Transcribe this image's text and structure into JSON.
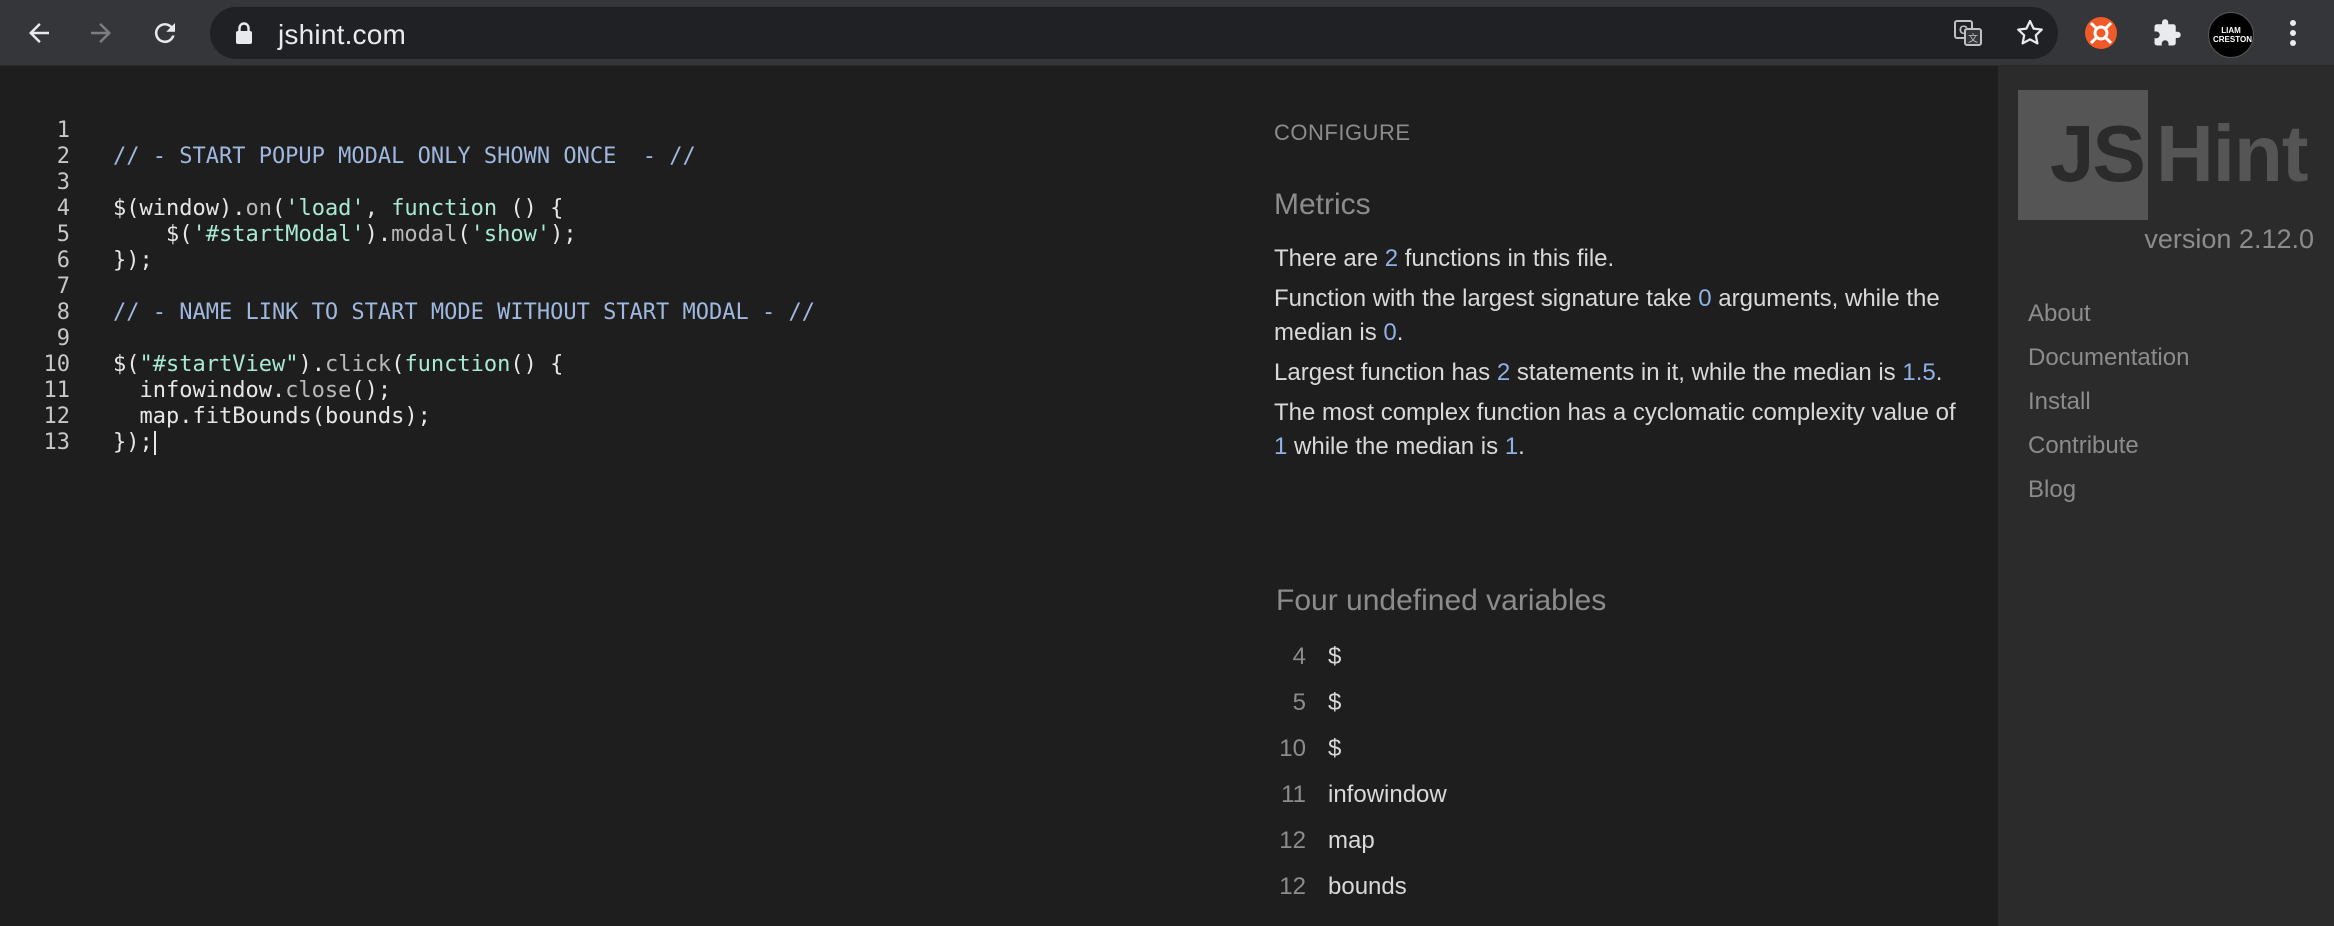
{
  "browser": {
    "url": "jshint.com",
    "profile_initials": "LIAM CRESTON"
  },
  "editor": {
    "lines": [
      {
        "n": "1",
        "tokens": []
      },
      {
        "n": "2",
        "tokens": [
          {
            "t": "// - START POPUP MODAL ONLY SHOWN ONCE  - //",
            "c": "com"
          }
        ]
      },
      {
        "n": "3",
        "tokens": []
      },
      {
        "n": "4",
        "tokens": [
          {
            "t": "$(window).",
            "c": "def"
          },
          {
            "t": "on",
            "c": "prop"
          },
          {
            "t": "(",
            "c": "def"
          },
          {
            "t": "'load'",
            "c": "str"
          },
          {
            "t": ", ",
            "c": "def"
          },
          {
            "t": "function",
            "c": "kw"
          },
          {
            "t": " () {",
            "c": "def"
          }
        ]
      },
      {
        "n": "5",
        "tokens": [
          {
            "t": "    $(",
            "c": "def"
          },
          {
            "t": "'#startModal'",
            "c": "str"
          },
          {
            "t": ").",
            "c": "def"
          },
          {
            "t": "modal",
            "c": "prop"
          },
          {
            "t": "(",
            "c": "def"
          },
          {
            "t": "'show'",
            "c": "str"
          },
          {
            "t": ");",
            "c": "def"
          }
        ]
      },
      {
        "n": "6",
        "tokens": [
          {
            "t": "});",
            "c": "def"
          }
        ]
      },
      {
        "n": "7",
        "tokens": []
      },
      {
        "n": "8",
        "tokens": [
          {
            "t": "// - NAME LINK TO START MODE WITHOUT START MODAL - //",
            "c": "com"
          }
        ]
      },
      {
        "n": "9",
        "tokens": []
      },
      {
        "n": "10",
        "tokens": [
          {
            "t": "$(",
            "c": "def"
          },
          {
            "t": "\"#startView\"",
            "c": "str"
          },
          {
            "t": ").",
            "c": "def"
          },
          {
            "t": "click",
            "c": "prop"
          },
          {
            "t": "(",
            "c": "def"
          },
          {
            "t": "function",
            "c": "kw"
          },
          {
            "t": "() {",
            "c": "def"
          }
        ]
      },
      {
        "n": "11",
        "tokens": [
          {
            "t": "  infowindow.",
            "c": "def"
          },
          {
            "t": "close",
            "c": "prop"
          },
          {
            "t": "();",
            "c": "def"
          }
        ]
      },
      {
        "n": "12",
        "tokens": [
          {
            "t": "  map.",
            "c": "def"
          },
          {
            "t": "fitBounds",
            "c": "def"
          },
          {
            "t": "(bounds);",
            "c": "def"
          }
        ]
      },
      {
        "n": "13",
        "tokens": [
          {
            "t": "});",
            "c": "def"
          }
        ],
        "cursor": true
      }
    ]
  },
  "report": {
    "configure_label": "CONFIGURE",
    "metrics_title": "Metrics",
    "metrics": [
      [
        {
          "t": "There are "
        },
        {
          "t": "2",
          "num": true
        },
        {
          "t": " functions in this file."
        }
      ],
      [
        {
          "t": "Function with the largest signature take "
        },
        {
          "t": "0",
          "num": true
        },
        {
          "t": " arguments, while the median is "
        },
        {
          "t": "0",
          "num": true
        },
        {
          "t": "."
        }
      ],
      [
        {
          "t": "Largest function has "
        },
        {
          "t": "2",
          "num": true
        },
        {
          "t": " statements in it, while the median is "
        },
        {
          "t": "1.5",
          "num": true
        },
        {
          "t": "."
        }
      ],
      [
        {
          "t": "The most complex function has a cyclomatic complexity value of "
        },
        {
          "t": "1",
          "num": true
        },
        {
          "t": " while the median is "
        },
        {
          "t": "1",
          "num": true
        },
        {
          "t": "."
        }
      ]
    ],
    "undefined_title": "Four undefined variables",
    "undefined": [
      {
        "line": "4",
        "name": "$"
      },
      {
        "line": "5",
        "name": "$"
      },
      {
        "line": "10",
        "name": "$"
      },
      {
        "line": "11",
        "name": "infowindow"
      },
      {
        "line": "12",
        "name": "map"
      },
      {
        "line": "12",
        "name": "bounds"
      }
    ]
  },
  "sidebar": {
    "logo_js": "JS",
    "logo_hint": "Hint",
    "version": "version 2.12.0",
    "links": [
      "About",
      "Documentation",
      "Install",
      "Contribute",
      "Blog"
    ]
  }
}
